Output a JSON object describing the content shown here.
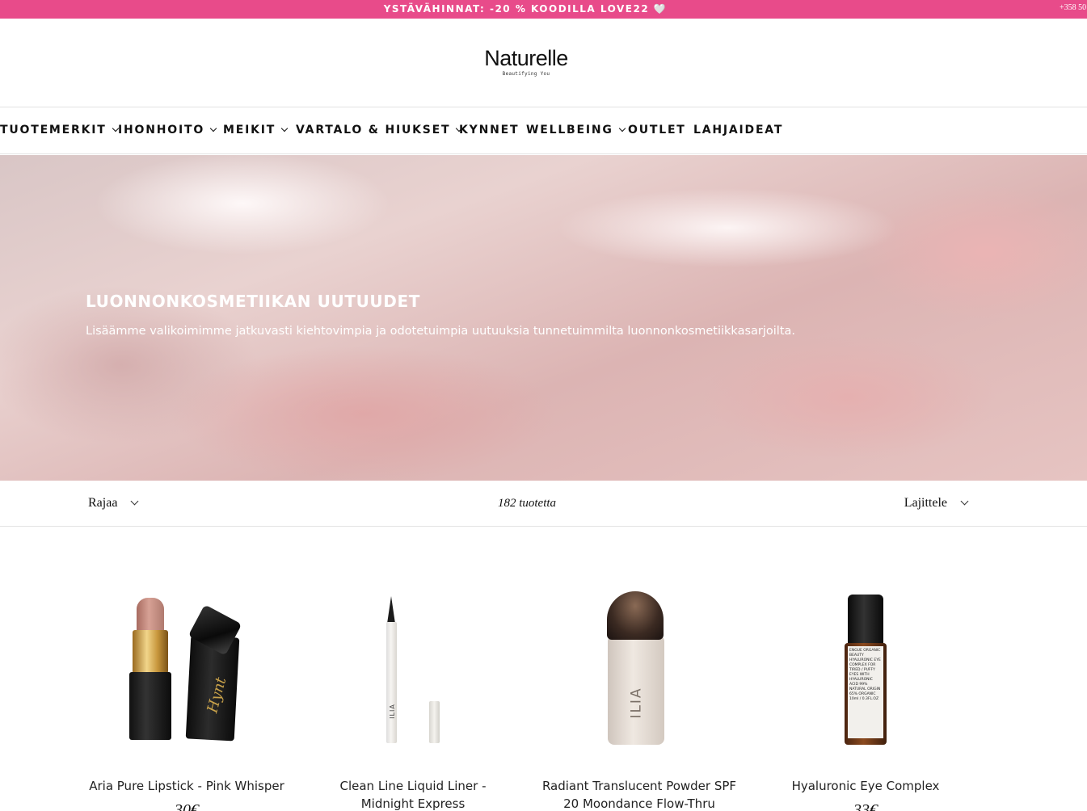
{
  "announcement": {
    "text": "YSTÄVÄHINNAT: -20 % KOODILLA LOVE22 🤍",
    "phone": "+358 50"
  },
  "header": {
    "logo": "Naturelle",
    "tagline": "Beautifying You"
  },
  "nav": {
    "items": [
      {
        "label": "TUOTEMERKIT",
        "dropdown": true
      },
      {
        "label": "IHONHOITO",
        "dropdown": true
      },
      {
        "label": "MEIKIT",
        "dropdown": true
      },
      {
        "label": "VARTALO & HIUKSET",
        "dropdown": true
      },
      {
        "label": "KYNNET",
        "dropdown": false
      },
      {
        "label": "WELLBEING",
        "dropdown": true
      },
      {
        "label": "OUTLET",
        "dropdown": false
      },
      {
        "label": "LAHJAIDEAT",
        "dropdown": false
      }
    ]
  },
  "hero": {
    "title": "LUONNONKOSMETIIKAN UUTUUDET",
    "subtitle": "Lisäämme valikoimimme jatkuvasti kiehtovimpia ja odotetuimpia uutuuksia tunnetuimmilta luonnonkosmetiikkasarjoilta."
  },
  "toolbar": {
    "filter_label": "Rajaa",
    "count": "182 tuotetta",
    "sort_label": "Lajittele"
  },
  "products": [
    {
      "name": "Aria Pure Lipstick - Pink Whisper",
      "price": "30€"
    },
    {
      "name": "Clean Line Liquid Liner - Midnight Express",
      "price": ""
    },
    {
      "name": "Radiant Translucent Powder SPF 20 Moondance Flow-Thru",
      "price": ""
    },
    {
      "name": "Hyaluronic Eye Complex",
      "price": "33€"
    }
  ],
  "product_art": {
    "lipstick_script": "Hynt",
    "liner_brand": "ILIA",
    "powder_brand": "ILIA",
    "bottle_label": "ENGUE ORGANIC BEAUTY HYALURONIC EYE COMPLEX FOR TIRED / PUFFY EYES WITH HYALURONIC ACID 99% NATURAL ORIGIN 65% ORGANIC 10ml / 0.3FL.OZ"
  },
  "colors": {
    "announcement_bg": "#e84b8a",
    "text": "#111111",
    "divider": "#e3e3e3"
  }
}
